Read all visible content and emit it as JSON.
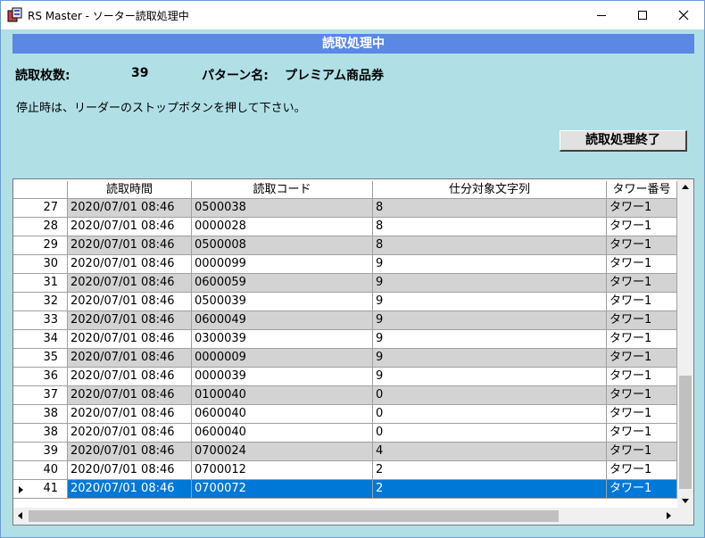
{
  "window": {
    "title": "RS Master - ソーター読取処理中"
  },
  "banner": {
    "text": "読取処理中"
  },
  "info": {
    "count_label": "読取枚数:",
    "count_value": "39",
    "pattern_label": "パターン名:",
    "pattern_value": "プレミアム商品券"
  },
  "message": "停止時は、リーダーのストップボタンを押して下さい。",
  "end_button": "読取処理終了",
  "grid": {
    "columns": [
      "",
      "読取時間",
      "読取コード",
      "仕分対象文字列",
      "タワー番号"
    ],
    "rows": [
      {
        "num": "27",
        "time": "2020/07/01 08:46",
        "code": "0500038",
        "sort": "8",
        "tower": "タワー1",
        "style": "gray"
      },
      {
        "num": "28",
        "time": "2020/07/01 08:46",
        "code": "0000028",
        "sort": "8",
        "tower": "タワー1",
        "style": "white"
      },
      {
        "num": "29",
        "time": "2020/07/01 08:46",
        "code": "0500008",
        "sort": "8",
        "tower": "タワー1",
        "style": "gray"
      },
      {
        "num": "30",
        "time": "2020/07/01 08:46",
        "code": "0000099",
        "sort": "9",
        "tower": "タワー1",
        "style": "white"
      },
      {
        "num": "31",
        "time": "2020/07/01 08:46",
        "code": "0600059",
        "sort": "9",
        "tower": "タワー1",
        "style": "gray"
      },
      {
        "num": "32",
        "time": "2020/07/01 08:46",
        "code": "0500039",
        "sort": "9",
        "tower": "タワー1",
        "style": "white"
      },
      {
        "num": "33",
        "time": "2020/07/01 08:46",
        "code": "0600049",
        "sort": "9",
        "tower": "タワー1",
        "style": "gray"
      },
      {
        "num": "34",
        "time": "2020/07/01 08:46",
        "code": "0300039",
        "sort": "9",
        "tower": "タワー1",
        "style": "white"
      },
      {
        "num": "35",
        "time": "2020/07/01 08:46",
        "code": "0000009",
        "sort": "9",
        "tower": "タワー1",
        "style": "gray"
      },
      {
        "num": "36",
        "time": "2020/07/01 08:46",
        "code": "0000039",
        "sort": "9",
        "tower": "タワー1",
        "style": "white"
      },
      {
        "num": "37",
        "time": "2020/07/01 08:46",
        "code": "0100040",
        "sort": "0",
        "tower": "タワー1",
        "style": "gray"
      },
      {
        "num": "38",
        "time": "2020/07/01 08:46",
        "code": "0600040",
        "sort": "0",
        "tower": "タワー1",
        "style": "white"
      },
      {
        "num": "38",
        "time": "2020/07/01 08:46",
        "code": "0600040",
        "sort": "0",
        "tower": "タワー1",
        "style": "white"
      },
      {
        "num": "39",
        "time": "2020/07/01 08:46",
        "code": "0700024",
        "sort": "4",
        "tower": "タワー1",
        "style": "gray"
      },
      {
        "num": "40",
        "time": "2020/07/01 08:46",
        "code": "0700012",
        "sort": "2",
        "tower": "タワー1",
        "style": "white"
      },
      {
        "num": "41",
        "time": "2020/07/01 08:46",
        "code": "0700072",
        "sort": "2",
        "tower": "タワー1",
        "style": "sel"
      }
    ]
  },
  "colors": {
    "background": "#b0e0e6",
    "banner": "#5b87e6",
    "selected_row": "#0078d7",
    "alt_row": "#d3d3d3"
  },
  "icons": [
    "app-icon",
    "minimize-icon",
    "maximize-icon",
    "close-icon",
    "row-selector-icon",
    "scroll-up-icon",
    "scroll-down-icon",
    "scroll-left-icon",
    "scroll-right-icon"
  ]
}
